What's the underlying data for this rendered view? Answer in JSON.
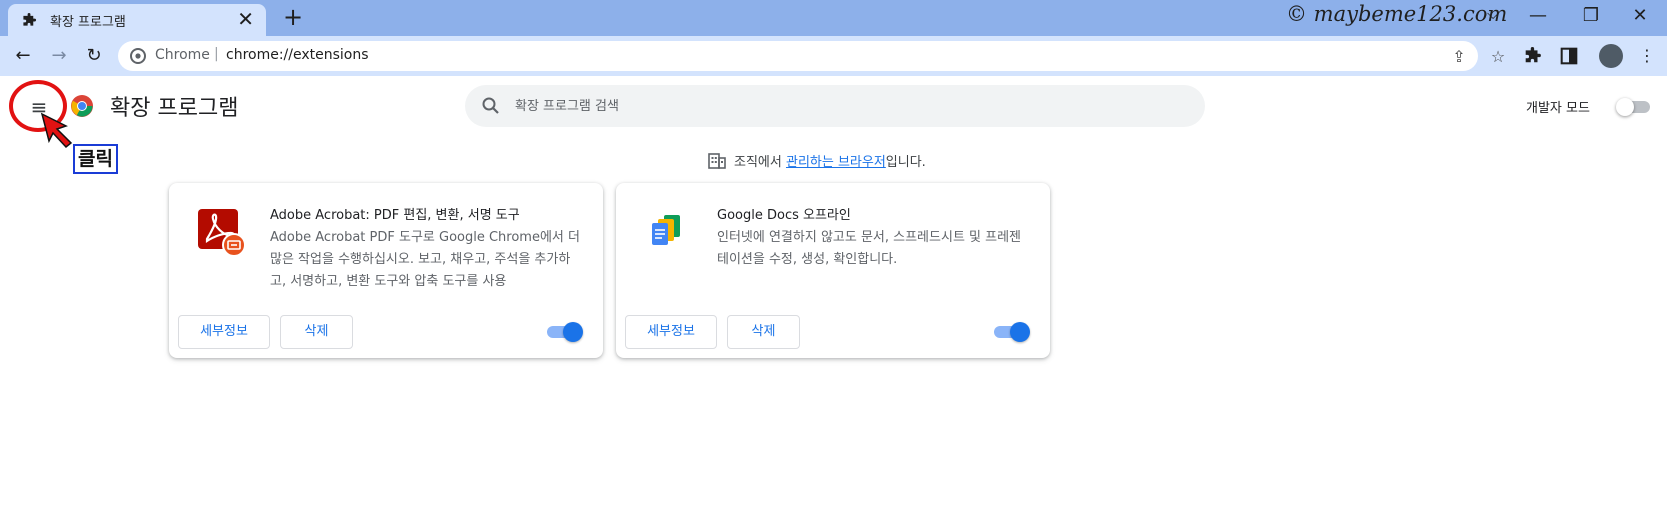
{
  "tab": {
    "title": "확장 프로그램",
    "close_label": "✕",
    "new_tab_label": "+"
  },
  "window": {
    "account": "© maybeme123.com",
    "chevron": "⌵",
    "minimize": "—",
    "restore": "❐",
    "close": "✕"
  },
  "toolbar": {
    "back": "←",
    "forward": "→",
    "reload": "↻",
    "scheme": "Chrome",
    "separator": "|",
    "url": "chrome://extensions"
  },
  "header": {
    "menu_icon": "≡",
    "title": "확장 프로그램",
    "search_placeholder": "확장 프로그램 검색",
    "dev_mode_label": "개발자 모드",
    "dev_mode_on": false
  },
  "annotation": {
    "label": "클릭",
    "circle_color": "#e21212",
    "box_color": "#1a3cd6"
  },
  "managed_notice": {
    "prefix": "조직에서 ",
    "link": "관리하는 브라우저",
    "suffix": "입니다."
  },
  "extensions": [
    {
      "name": "Adobe Acrobat: PDF 편집, 변환, 서명 도구",
      "description": "Adobe Acrobat PDF 도구로 Google Chrome에서 더 많은 작업을 수행하십시오. 보고, 채우고, 주석을 추가하고, 서명하고, 변환 도구와 압축 도구를 사용",
      "details_label": "세부정보",
      "remove_label": "삭제",
      "enabled": true
    },
    {
      "name": "Google Docs 오프라인",
      "description": "인터넷에 연결하지 않고도 문서, 스프레드시트 및 프레젠테이션을 수정, 생성, 확인합니다.",
      "details_label": "세부정보",
      "remove_label": "삭제",
      "enabled": true
    }
  ],
  "colors": {
    "tabstrip": "#8db0ea",
    "toolbar": "#d3e3fd",
    "accent": "#1a73e8"
  }
}
